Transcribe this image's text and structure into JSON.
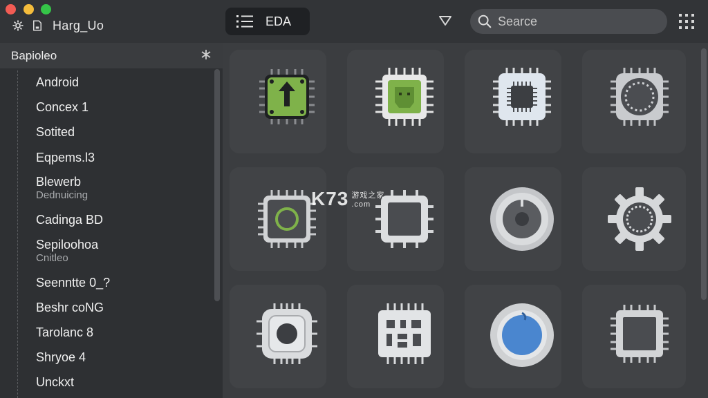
{
  "window": {
    "title": "Harg_Uo"
  },
  "toolbar": {
    "view_label": "EDA",
    "search_placeholder": "Searce",
    "icons": [
      "gear-icon",
      "document-icon",
      "list-icon",
      "filter-icon",
      "search-icon",
      "grid-icon"
    ]
  },
  "sidebar": {
    "title": "Bapioleo",
    "items": [
      {
        "label": "Android",
        "sub": ""
      },
      {
        "label": "Concex 1",
        "sub": ""
      },
      {
        "label": "Sotited",
        "sub": ""
      },
      {
        "label": "Eqpems.l3",
        "sub": ""
      },
      {
        "label": "Blewerb",
        "sub": "Dednuicing"
      },
      {
        "label": "Cadinga BD",
        "sub": ""
      },
      {
        "label": "Sepiloohoa",
        "sub": "Cnitleo"
      },
      {
        "label": "Seenntte 0_?",
        "sub": ""
      },
      {
        "label": "Beshr coNG",
        "sub": ""
      },
      {
        "label": "Tarolanc 8",
        "sub": ""
      },
      {
        "label": "Shryoe 4",
        "sub": ""
      },
      {
        "label": "Unckxt",
        "sub": ""
      }
    ]
  },
  "grid": {
    "tiles": [
      {
        "icon": "chip-upload-icon"
      },
      {
        "icon": "chip-robot-icon"
      },
      {
        "icon": "chip-processor-icon"
      },
      {
        "icon": "chip-dial-icon"
      },
      {
        "icon": "chip-ring-icon"
      },
      {
        "icon": "chip-square-icon"
      },
      {
        "icon": "dial-knob-icon"
      },
      {
        "icon": "gear-large-icon"
      },
      {
        "icon": "chip-rounded-icon"
      },
      {
        "icon": "chip-pattern-icon"
      },
      {
        "icon": "blue-orb-icon"
      },
      {
        "icon": "chip-dark-square-icon"
      }
    ]
  },
  "watermark": {
    "text": "K73",
    "sub_cn": "游戏之家",
    "sub_domain": ".com"
  },
  "colors": {
    "accent_green": "#7fb24a",
    "accent_blue": "#4a86cf",
    "window_bg": "#2b2d30"
  }
}
